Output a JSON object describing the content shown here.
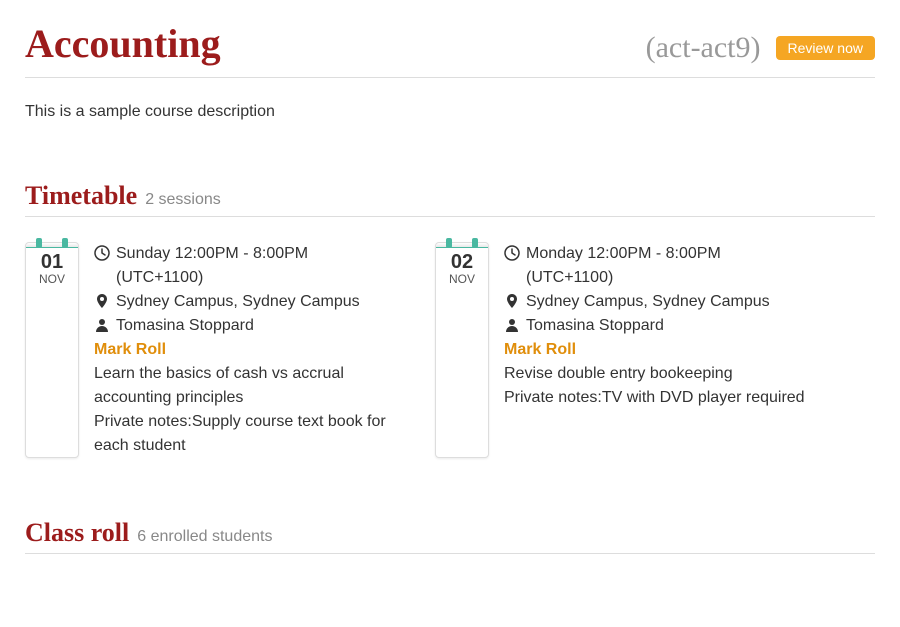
{
  "course": {
    "title": "Accounting",
    "code": "(act-act9)",
    "review_button": "Review now",
    "description": "This is a sample course description"
  },
  "timetable": {
    "heading": "Timetable",
    "subheading": "2 sessions",
    "sessions": [
      {
        "day": "01",
        "month": "NOV",
        "time": "Sunday 12:00PM - 8:00PM (UTC+1100)",
        "location": "Sydney Campus, Sydney Campus",
        "instructor": "Tomasina Stoppard",
        "mark_roll": "Mark Roll",
        "desc": "Learn the basics of cash vs accrual accounting principles",
        "notes": "Private notes:Supply course text book for each student"
      },
      {
        "day": "02",
        "month": "NOV",
        "time": "Monday 12:00PM - 8:00PM (UTC+1100)",
        "location": "Sydney Campus, Sydney Campus",
        "instructor": "Tomasina Stoppard",
        "mark_roll": "Mark Roll",
        "desc": "Revise double entry bookeeping",
        "notes": "Private notes:TV with DVD player required"
      }
    ]
  },
  "classroll": {
    "heading": "Class roll",
    "subheading": "6 enrolled students"
  }
}
